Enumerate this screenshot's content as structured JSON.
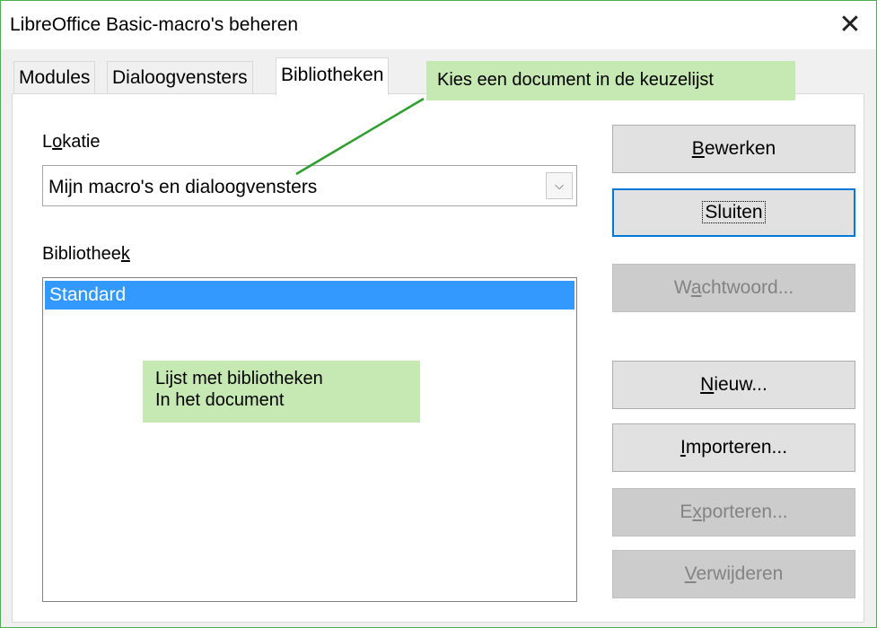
{
  "window": {
    "title": "LibreOffice Basic-macro's beheren",
    "close_glyph": "✕"
  },
  "tabs": [
    {
      "label": "Modules",
      "active": false
    },
    {
      "label": "Dialoogvensters",
      "active": false
    },
    {
      "label": "Bibliotheken",
      "active": true
    }
  ],
  "location": {
    "label_pre": "L",
    "label_accel": "o",
    "label_post": "katie",
    "selected": "Mijn macro's en dialoogvensters",
    "arrow_glyph": "⌵"
  },
  "library": {
    "label_pre": "Bibliothee",
    "label_accel": "k",
    "label_post": "",
    "items": [
      {
        "label": "Standard",
        "selected": true
      }
    ]
  },
  "buttons": {
    "edit": {
      "pre": "",
      "accel": "B",
      "post": "ewerken",
      "enabled": true
    },
    "close": {
      "label": "Sluiten",
      "enabled": true
    },
    "password": {
      "pre": "W",
      "accel": "a",
      "post": "chtwoord...",
      "enabled": false
    },
    "new": {
      "pre": "",
      "accel": "N",
      "post": "ieuw...",
      "enabled": true
    },
    "import": {
      "pre": "",
      "accel": "I",
      "post": "mporteren...",
      "enabled": true
    },
    "export": {
      "pre": "E",
      "accel": "x",
      "post": "porteren...",
      "enabled": false
    },
    "delete": {
      "pre": "",
      "accel": "V",
      "post": "erwijderen",
      "enabled": false
    }
  },
  "annotations": {
    "location_hint": "Kies een document in de keuzelijst",
    "list_hint_line1": "Lijst met bibliotheken",
    "list_hint_line2": "In het document",
    "callout_color": "#c6e9b4",
    "pointer_color": "#2e9e2e"
  },
  "colors": {
    "selection": "#3399ff",
    "default_button_border": "#0078d7"
  }
}
